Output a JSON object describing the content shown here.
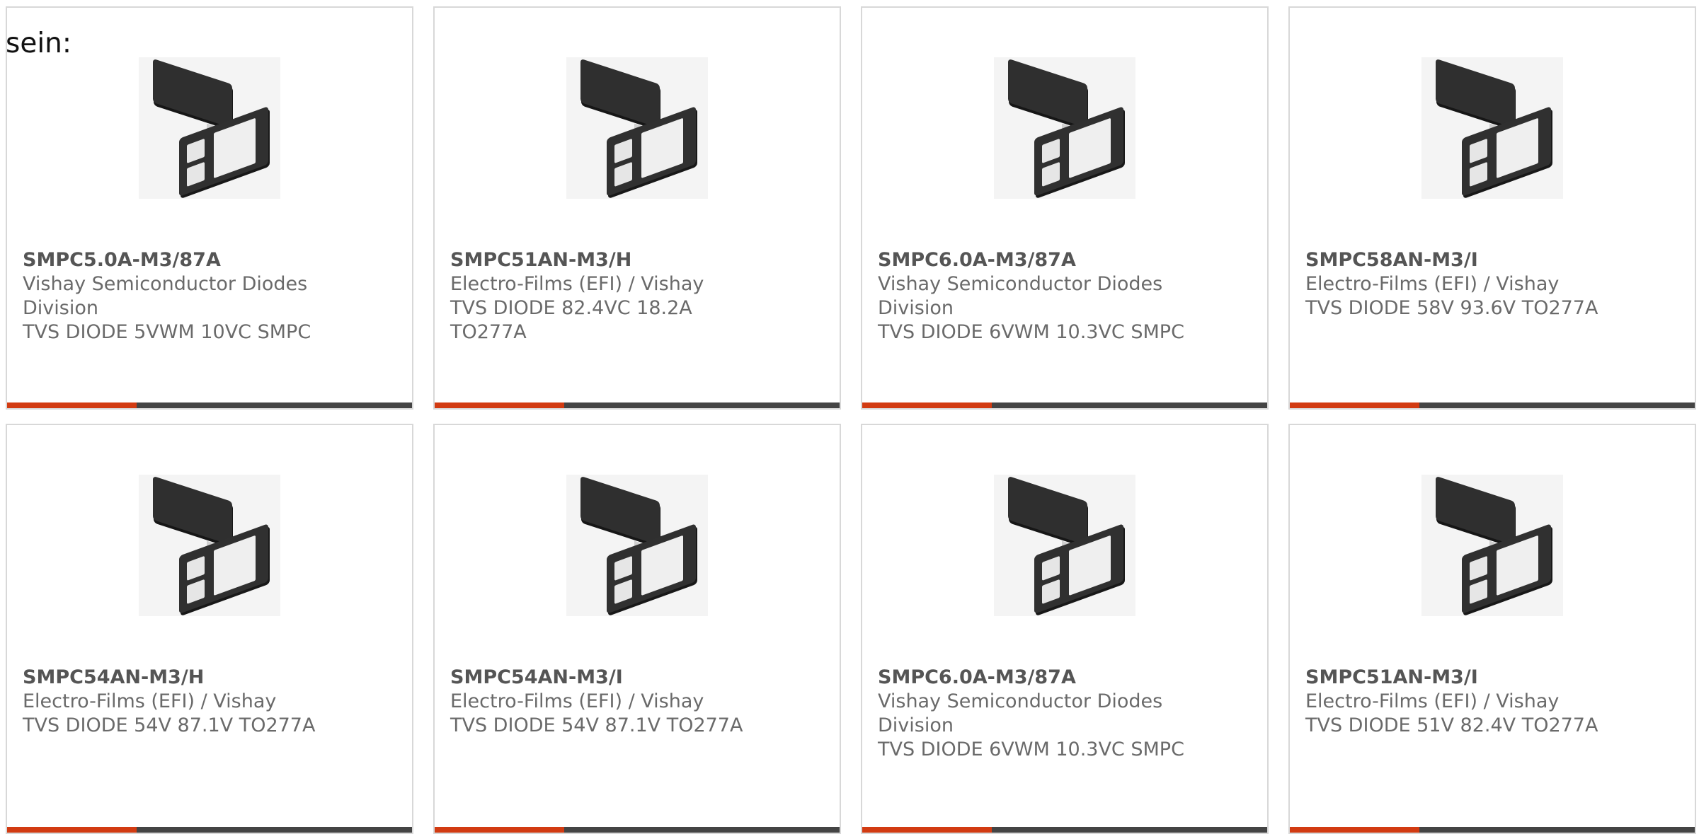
{
  "page": {
    "intro_text": "sein:"
  },
  "colors": {
    "accent": "#d23b12",
    "bar": "#444444",
    "card_border": "#d8d8d8"
  },
  "products": [
    {
      "part": "SMPC5.0A-M3/87A",
      "lines": [
        "Vishay Semiconductor Diodes",
        "Division",
        "TVS DIODE 5VWM 10VC SMPC"
      ]
    },
    {
      "part": "SMPC51AN-M3/H",
      "lines": [
        "Electro-Films (EFI) / Vishay",
        "TVS DIODE 82.4VC 18.2A",
        "TO277A"
      ]
    },
    {
      "part": "SMPC6.0A-M3/87A",
      "lines": [
        "Vishay Semiconductor Diodes",
        "Division",
        "TVS DIODE 6VWM 10.3VC SMPC"
      ]
    },
    {
      "part": "SMPC58AN-M3/I",
      "lines": [
        "Electro-Films (EFI) / Vishay",
        "TVS DIODE 58V 93.6V TO277A"
      ]
    },
    {
      "part": "SMPC54AN-M3/H",
      "lines": [
        "Electro-Films (EFI) / Vishay",
        "TVS DIODE 54V 87.1V TO277A"
      ]
    },
    {
      "part": "SMPC54AN-M3/I",
      "lines": [
        "Electro-Films (EFI) / Vishay",
        "TVS DIODE 54V 87.1V TO277A"
      ]
    },
    {
      "part": "SMPC6.0A-M3/87A",
      "lines": [
        "Vishay Semiconductor Diodes",
        "Division",
        "TVS DIODE 6VWM 10.3VC SMPC"
      ]
    },
    {
      "part": "SMPC51AN-M3/I",
      "lines": [
        "Electro-Films (EFI) / Vishay",
        "TVS DIODE 51V 82.4V TO277A"
      ]
    }
  ]
}
